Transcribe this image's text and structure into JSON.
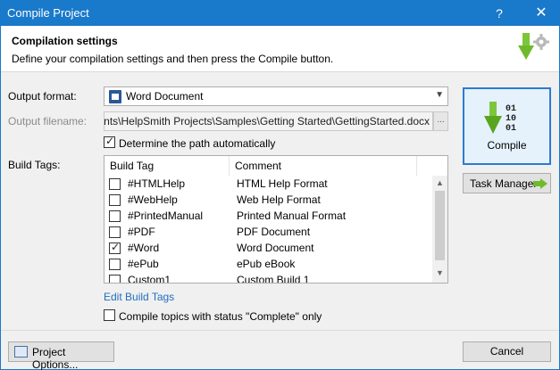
{
  "window": {
    "title": "Compile Project",
    "help_glyph": "?",
    "close_glyph": "✕"
  },
  "header": {
    "title": "Compilation settings",
    "subtitle": "Define your compilation settings and then press the Compile button."
  },
  "output_format": {
    "label": "Output format:",
    "value": "Word Document"
  },
  "output_filename": {
    "label": "Output filename:",
    "value": "ocuments\\HelpSmith Projects\\Samples\\Getting Started\\GettingStarted.docx",
    "browse_label": "..."
  },
  "determine_path": {
    "label": "Determine the path automatically",
    "checked": true
  },
  "build_tags": {
    "label": "Build Tags:",
    "columns": [
      "Build Tag",
      "Comment"
    ],
    "rows": [
      {
        "tag": "#HTMLHelp",
        "comment": "HTML Help Format",
        "checked": false
      },
      {
        "tag": "#WebHelp",
        "comment": "Web Help Format",
        "checked": false
      },
      {
        "tag": "#PrintedManual",
        "comment": "Printed Manual Format",
        "checked": false
      },
      {
        "tag": "#PDF",
        "comment": "PDF Document",
        "checked": false
      },
      {
        "tag": "#Word",
        "comment": "Word Document",
        "checked": true
      },
      {
        "tag": "#ePub",
        "comment": "ePub eBook",
        "checked": false
      },
      {
        "tag": "Custom1",
        "comment": "Custom Build 1",
        "checked": false
      }
    ],
    "edit_link": "Edit Build Tags"
  },
  "compile_status": {
    "label": "Compile topics with status \"Complete\" only",
    "checked": false
  },
  "buttons": {
    "compile": "Compile",
    "task_manager": "Task Manager",
    "project_options": "Project Options...",
    "cancel": "Cancel"
  },
  "icons": {
    "header": "compile-gear-icon",
    "compile": "binary-download-icon",
    "task_manager": "green-arrow-right-icon",
    "project_options": "project-options-icon",
    "format": "word-document-icon"
  },
  "colors": {
    "titlebar": "#1979ca",
    "link": "#1f6fbf",
    "accent_green": "#6fba2c"
  }
}
